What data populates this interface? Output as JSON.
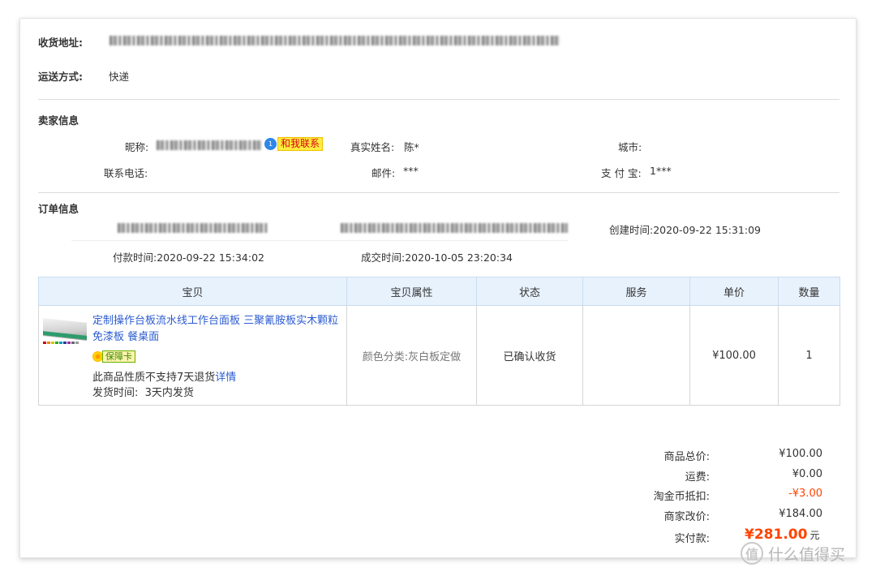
{
  "address": {
    "label": "收货地址:"
  },
  "shipping": {
    "label": "运送方式:",
    "value": "快递"
  },
  "seller": {
    "section_title": "卖家信息",
    "nickname_label": "昵称:",
    "contact_text": "和我联系",
    "realname_label": "真实姓名:",
    "realname_value": "陈*",
    "city_label": "城市:",
    "phone_label": "联系电话:",
    "email_label": "邮件:",
    "email_value": "***",
    "alipay_label": "支 付 宝:",
    "alipay_value": "1***"
  },
  "order": {
    "section_title": "订单信息",
    "created_label": "创建时间:",
    "created_value": "2020-09-22 15:31:09",
    "paid_label": "付款时间:",
    "paid_value": "2020-09-22 15:34:02",
    "deal_label": "成交时间:",
    "deal_value": "2020-10-05 23:20:34"
  },
  "table": {
    "headers": [
      "宝贝",
      "宝贝属性",
      "状态",
      "服务",
      "单价",
      "数量"
    ],
    "item": {
      "title": "定制操作台板流水线工作台面板 三聚氰胺板实木颗粒免漆板 餐桌面",
      "badge": "保障卡",
      "return_text": "此商品性质不支持7天退货",
      "return_link": "详情",
      "ship_label": "发货时间:",
      "ship_value": "3天内发货",
      "attribute": "颜色分类:灰白板定做",
      "status": "已确认收货",
      "service": "",
      "price": "¥100.00",
      "qty": "1"
    }
  },
  "summary": {
    "goods_label": "商品总价:",
    "goods_value": "¥100.00",
    "freight_label": "运费:",
    "freight_value": "¥0.00",
    "coin_label": "淘金币抵扣:",
    "coin_value": "-¥3.00",
    "adjust_label": "商家改价:",
    "adjust_value": "¥184.00",
    "paid_label": "实付款:",
    "paid_value": "¥281.00",
    "paid_unit": "元"
  },
  "watermark": {
    "symbol": "值",
    "text": "什么值得买"
  },
  "colors": {
    "link": "#2b5bd0",
    "price_red": "#ff4400",
    "header_bg": "#e8f2fd"
  }
}
